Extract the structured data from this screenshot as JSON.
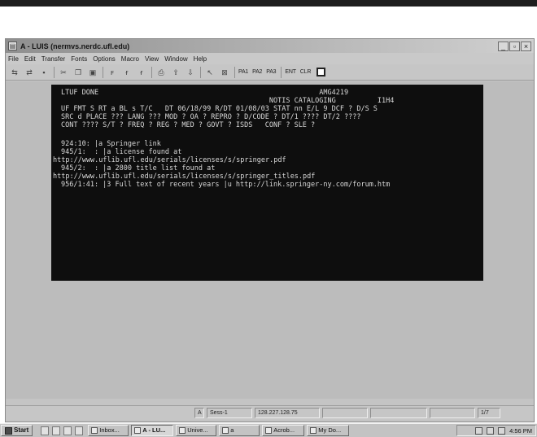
{
  "window": {
    "title": "A - LUIS (nermvs.nerdc.ufl.edu)",
    "controls": [
      "_",
      "▫",
      "×"
    ]
  },
  "menu": [
    "File",
    "Edit",
    "Transfer",
    "Fonts",
    "Options",
    "Macro",
    "View",
    "Window",
    "Help"
  ],
  "toolbar": {
    "text_buttons": [
      "PA1",
      "PA2",
      "PA3",
      "ENT",
      "CLR"
    ]
  },
  "terminal": {
    "lines": [
      "LTUF DONE                                                     AMG4219",
      "                                                  NOTIS CATALOGING          I1H4",
      "UF FMT S RT a BL s T/C   DT 06/18/99 R/DT 01/08/03 STAT nn E/L 9 DCF ? D/S S",
      "SRC d PLACE ??? LANG ??? MOD ? OA ? REPRO ? D/CODE ? DT/1 ???? DT/2 ????",
      "CONT ???? S/T ? FREQ ? REG ? MED ? GOVT ? ISDS   CONF ? SLE ?",
      "",
      "924:10: |a Springer link",
      "945/1:  : |a license found at",
      "http://www.uflib.ufl.edu/serials/licenses/s/springer.pdf",
      "945/2:  : |a 2800 title list found at",
      "http://www.uflib.ufl.edu/serials/licenses/s/springer_titles.pdf",
      "956/1:41: |3 Full text of recent years |u http://link.springer-ny.com/forum.htm"
    ]
  },
  "statusbar": {
    "cells": [
      "A",
      "Sess-1",
      "128.227.128.75",
      "",
      "",
      "",
      "1/7"
    ]
  },
  "taskbar": {
    "start": "Start",
    "tasks": [
      "Inbox...",
      "A - LU...",
      "Unive...",
      "a",
      "Acrob...",
      "My Do..."
    ],
    "time": "4:56 PM"
  }
}
